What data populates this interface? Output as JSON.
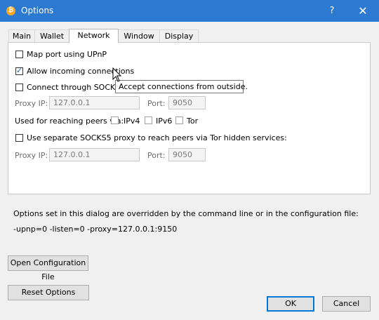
{
  "window": {
    "title": "Options",
    "icon": "bitcoin-icon",
    "help_glyph": "?",
    "close_glyph": "✕"
  },
  "tabs": [
    {
      "label": "Main",
      "active": false
    },
    {
      "label": "Wallet",
      "active": false
    },
    {
      "label": "Network",
      "active": true
    },
    {
      "label": "Window",
      "active": false
    },
    {
      "label": "Display",
      "active": false
    }
  ],
  "network": {
    "upnp_label": "Map port using UPnP",
    "upnp_checked": false,
    "allow_incoming_label": "Allow incoming connections",
    "allow_incoming_checked": true,
    "socks5_label": "Connect through SOCKS5 p",
    "socks5_checked": false,
    "proxy_ip_label": "Proxy IP:",
    "proxy_ip_value": "127.0.0.1",
    "port_label": "Port:",
    "port_value": "9050",
    "reach_label": "Used for reaching peers via:",
    "ipv4_label": "IPv4",
    "ipv6_label": "IPv6",
    "tor_label": "Tor",
    "sep_socks5_label": "Use separate SOCKS5 proxy to reach peers via Tor hidden services:",
    "sep_socks5_checked": false,
    "tor_proxy_ip_label": "Proxy IP:",
    "tor_proxy_ip_value": "127.0.0.1",
    "tor_port_label": "Port:",
    "tor_port_value": "9050"
  },
  "tooltip": "Accept connections from outside.",
  "overridden_note": "Options set in this dialog are overridden by the command line or in the configuration file:",
  "overridden_args": "-upnp=0 -listen=0 -proxy=127.0.0.1:9150",
  "buttons": {
    "open_config": "Open Configuration File",
    "reset": "Reset Options",
    "ok": "OK",
    "cancel": "Cancel"
  }
}
